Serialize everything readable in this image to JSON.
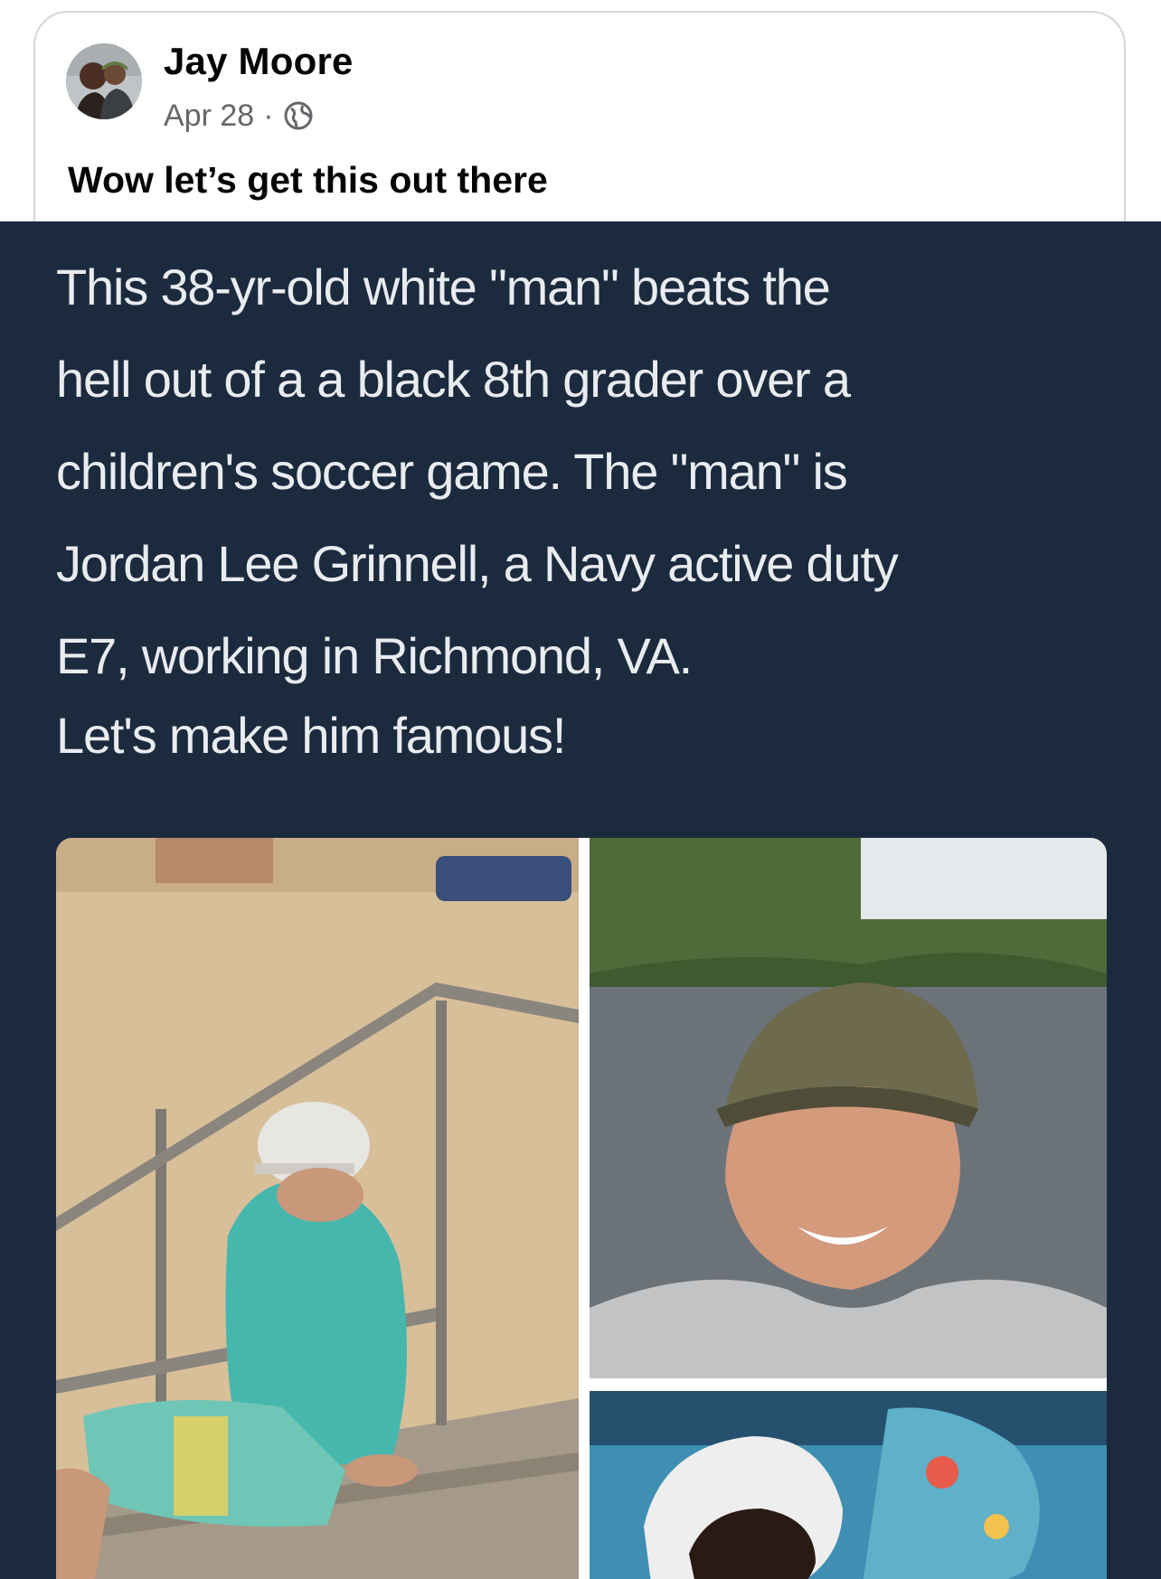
{
  "post": {
    "author": "Jay Moore",
    "date": "Apr 28",
    "separator": "·",
    "privacy_icon": "globe-icon",
    "text": "Wow let’s get this out there"
  },
  "shared_image": {
    "background_color": "#1c2a3e",
    "line1": "This 38-yr-old white \"man\" beats the",
    "line2": "hell out of a a black 8th grader over a",
    "line3": "children's soccer game. The \"man\" is",
    "line4": "Jordan Lee Grinnell, a Navy active duty",
    "line5": "E7, working in Richmond, VA.",
    "line6": "Let's make him famous!",
    "photos": [
      {
        "description_name": "man-on-beach-steps-photo"
      },
      {
        "description_name": "man-in-cap-selfie-photo"
      },
      {
        "description_name": "injured-boy-photo"
      }
    ]
  }
}
